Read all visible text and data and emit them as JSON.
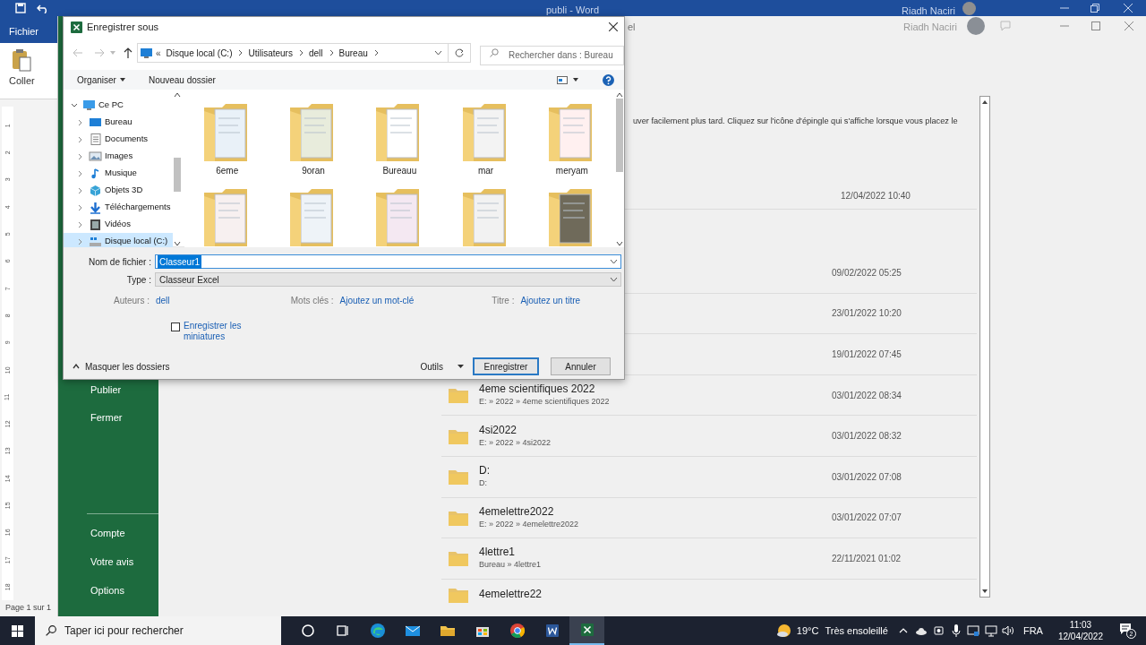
{
  "word": {
    "title": "publi - Word",
    "user": "Riadh Naciri",
    "tab": "Fichier",
    "paste": "Coller",
    "status": "Page 1 sur 1",
    "ruler_numbers": [
      "1",
      "2",
      "3",
      "4",
      "5",
      "6",
      "7",
      "8",
      "9",
      "10",
      "11",
      "12",
      "13",
      "14",
      "15",
      "16",
      "17",
      "18"
    ]
  },
  "excel": {
    "title_fragment": "el",
    "user": "Riadh Naciri",
    "sidebar_top": [
      "Publier",
      "Fermer"
    ],
    "sidebar_bottom": [
      "Compte",
      "Votre avis",
      "Options"
    ],
    "hint": "uver facilement plus tard. Cliquez sur l'icône d'épingle qui s'affiche lorsque vous placez le",
    "pinned_date": "12/04/2022 10:40",
    "recent": [
      {
        "date": "09/02/2022 05:25"
      },
      {
        "date": "23/01/2022 10:20"
      },
      {
        "date": "19/01/2022 07:45"
      },
      {
        "name": "4eme scientifiques 2022",
        "path": "E: » 2022 » 4eme scientifiques 2022",
        "date": "03/01/2022 08:34"
      },
      {
        "name": "4si2022",
        "path": "E: » 2022 » 4si2022",
        "date": "03/01/2022 08:32"
      },
      {
        "name": "D:",
        "path": "D:",
        "date": "03/01/2022 07:08"
      },
      {
        "name": "4emelettre2022",
        "path": "E: » 2022 » 4emelettre2022",
        "date": "03/01/2022 07:07"
      },
      {
        "name": "4lettre1",
        "path": "Bureau » 4lettre1",
        "date": "22/11/2021 01:02"
      },
      {
        "name": "4emelettre22"
      }
    ]
  },
  "dialog": {
    "title": "Enregistrer sous",
    "address_overflow": "«",
    "breadcrumb": [
      "Disque local (C:)",
      "Utilisateurs",
      "dell",
      "Bureau"
    ],
    "search": {
      "placeholder": "Rechercher dans : Bureau"
    },
    "toolbar": {
      "organize": "Organiser",
      "new_folder": "Nouveau dossier"
    },
    "tree": [
      {
        "label": "Ce PC",
        "kind": "pc",
        "expanded": true,
        "selected": false,
        "children": [
          {
            "label": "Bureau",
            "kind": "desktop",
            "selected": false
          },
          {
            "label": "Documents",
            "kind": "documents",
            "selected": false
          },
          {
            "label": "Images",
            "kind": "images",
            "selected": false
          },
          {
            "label": "Musique",
            "kind": "music",
            "selected": false
          },
          {
            "label": "Objets 3D",
            "kind": "objects",
            "selected": false
          },
          {
            "label": "Téléchargements",
            "kind": "downloads",
            "selected": false
          },
          {
            "label": "Vidéos",
            "kind": "videos",
            "selected": false
          },
          {
            "label": "Disque local (C:)",
            "kind": "drive",
            "selected": true
          }
        ]
      }
    ],
    "files": [
      {
        "kind": "folder",
        "label": "6eme"
      },
      {
        "kind": "folder",
        "label": "9oran"
      },
      {
        "kind": "folder",
        "label": "Bureauu"
      },
      {
        "kind": "folder",
        "label": "mar"
      },
      {
        "kind": "folder",
        "label": "meryam"
      },
      {
        "kind": "folder"
      },
      {
        "kind": "folder"
      },
      {
        "kind": "folder"
      },
      {
        "kind": "folder"
      },
      {
        "kind": "folder"
      }
    ],
    "filename": {
      "label": "Nom de fichier :",
      "value": "Classeur1",
      "selected": true
    },
    "type": {
      "label": "Type :",
      "value": "Classeur Excel"
    },
    "meta": [
      {
        "label": "Auteurs :",
        "value": "dell"
      },
      {
        "label": "Mots clés :",
        "value": "Ajoutez un mot-clé"
      },
      {
        "label": "Titre :",
        "value": "Ajoutez un titre"
      }
    ],
    "thumbnails": {
      "label": "Enregistrer les miniatures",
      "checked": false
    },
    "hide_folders": "Masquer les dossiers",
    "tools": "Outils",
    "save": "Enregistrer",
    "cancel": "Annuler"
  },
  "taskbar": {
    "search": {
      "placeholder": "Taper ici pour rechercher"
    },
    "apps": [
      {
        "kind": "cortana",
        "active": false
      },
      {
        "kind": "taskview",
        "active": false
      },
      {
        "kind": "edge",
        "active": false
      },
      {
        "kind": "mail",
        "active": false
      },
      {
        "kind": "explorer",
        "active": false
      },
      {
        "kind": "store",
        "active": false
      },
      {
        "kind": "chrome",
        "active": false
      },
      {
        "kind": "word",
        "active": false
      },
      {
        "kind": "excel",
        "active": true
      }
    ],
    "temperature": "19°C",
    "weather": "Très ensoleillé",
    "language": "FRA",
    "time": "11:03",
    "date": "12/04/2022",
    "notifications": "2"
  }
}
